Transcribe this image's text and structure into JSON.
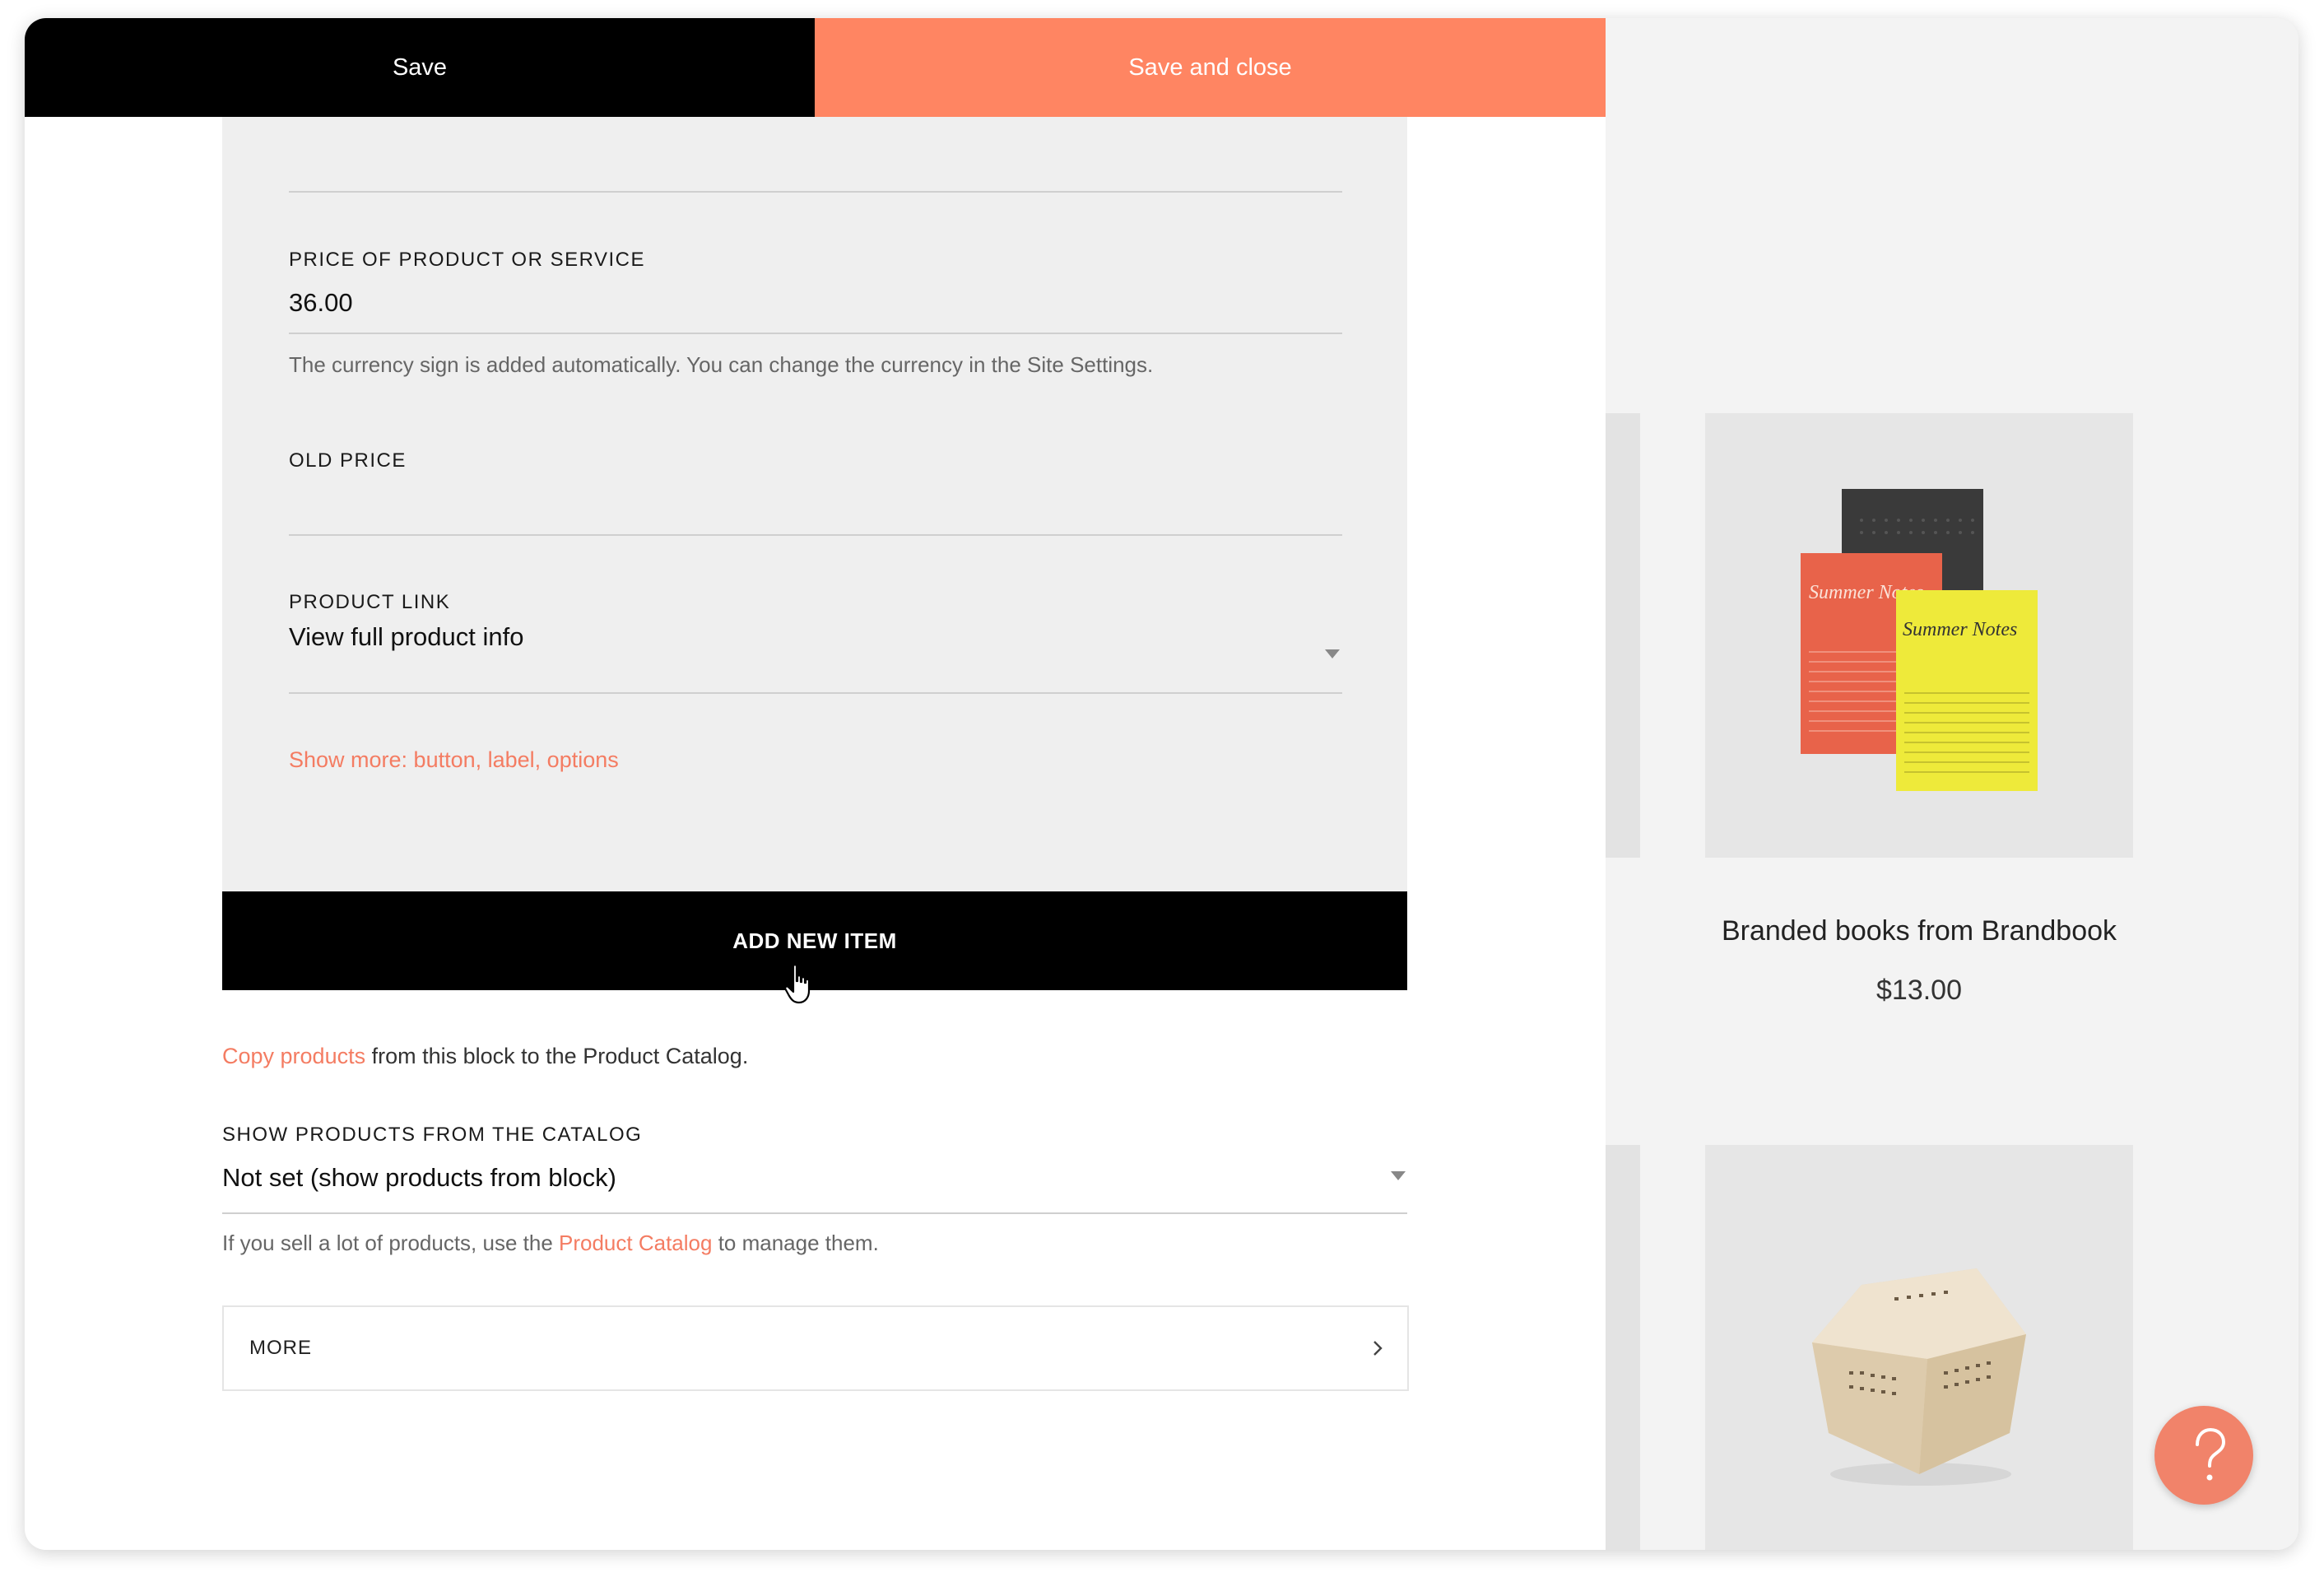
{
  "topbar": {
    "save_label": "Save",
    "save_close_label": "Save and close"
  },
  "form": {
    "price_label": "PRICE OF PRODUCT OR SERVICE",
    "price_value": "36.00",
    "price_hint": "The currency sign is added automatically. You can change the currency in the Site Settings.",
    "old_price_label": "OLD PRICE",
    "old_price_value": "",
    "product_link_label": "PRODUCT LINK",
    "product_link_value": "View full product info",
    "show_more_link": "Show more: button, label, options"
  },
  "add_item_label": "ADD NEW ITEM",
  "copy_line": {
    "link": "Copy products",
    "rest": " from this block to the Product Catalog."
  },
  "catalog": {
    "label": "SHOW PRODUCTS FROM THE CATALOG",
    "value": "Not set (show products from block)",
    "hint_before": "If you sell a lot of products, use the ",
    "hint_link": "Product Catalog",
    "hint_after": " to manage them."
  },
  "more_label": "MORE",
  "preview": {
    "product_title": "Branded books from Brandbook",
    "product_price": "$13.00",
    "notebook_text_1": "Summer Notes",
    "notebook_text_2": "Summer Notes"
  },
  "colors": {
    "accent": "#ff8562",
    "link": "#f47c62",
    "dark": "#000000"
  },
  "icons": {
    "help": "question-mark-icon",
    "more": "chevron-right-icon",
    "select": "caret-down-icon"
  }
}
